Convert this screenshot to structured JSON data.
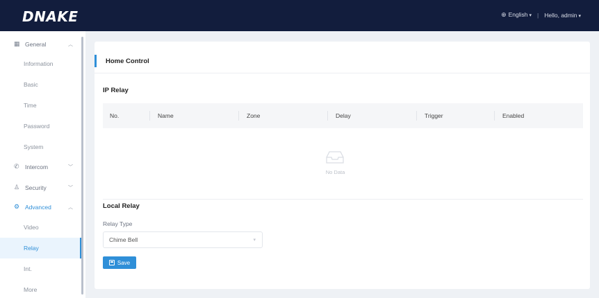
{
  "header": {
    "logo": "DNAKE",
    "language": "English",
    "greeting": "Hello, admin",
    "globe_icon": "globe-icon",
    "separator": "|"
  },
  "sidebar": {
    "groups": [
      {
        "label": "General",
        "icon": "building-icon",
        "expanded": true,
        "items": [
          "Information",
          "Basic",
          "Time",
          "Password",
          "System"
        ]
      },
      {
        "label": "Intercom",
        "icon": "phone-icon",
        "expanded": false
      },
      {
        "label": "Security",
        "icon": "person-shield-icon",
        "expanded": false
      },
      {
        "label": "Advanced",
        "icon": "gear-icon",
        "expanded": true,
        "items": [
          "Video",
          "Relay",
          "Int.",
          "More"
        ]
      }
    ],
    "selected": "Relay"
  },
  "main": {
    "title": "Home Control",
    "ip_relay": {
      "title": "IP Relay",
      "columns": [
        "No.",
        "Name",
        "Zone",
        "Delay",
        "Trigger",
        "Enabled"
      ],
      "rows": [],
      "empty_text": "No Data"
    },
    "local_relay": {
      "title": "Local Relay",
      "relay_type_label": "Relay Type",
      "relay_type_value": "Chime Bell"
    },
    "save_label": "Save"
  },
  "colors": {
    "topbar": "#121d3d",
    "accent": "#2f8fd8",
    "background": "#eef1f5"
  }
}
